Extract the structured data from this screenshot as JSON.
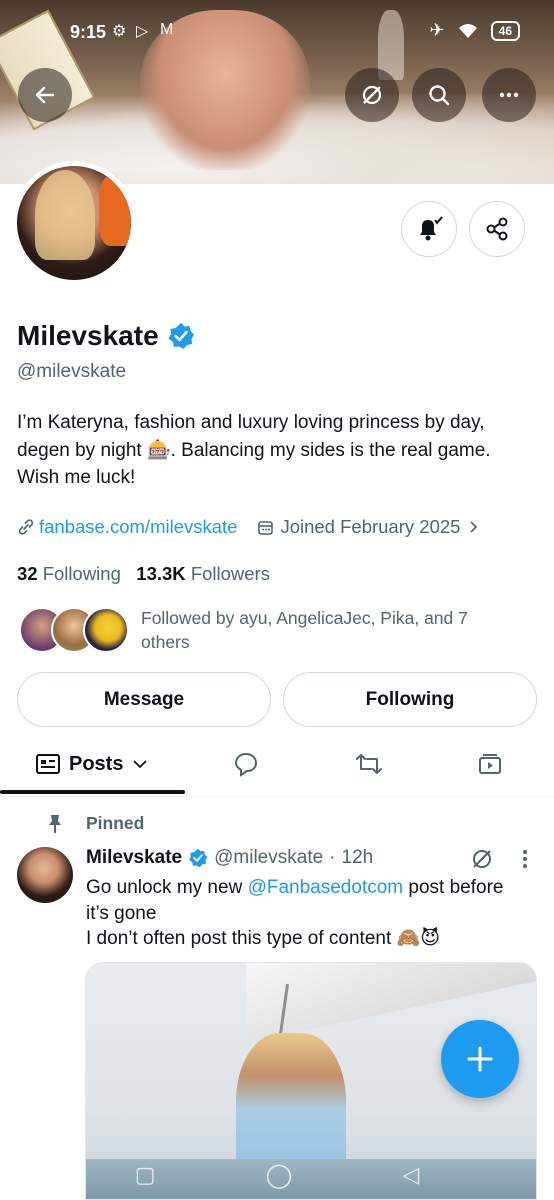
{
  "status_bar": {
    "time": "9:15",
    "left_icons": [
      "gear-icon",
      "play-store-icon",
      "gmail-icon"
    ],
    "right_icons": [
      "airplane-icon",
      "wifi-icon"
    ],
    "battery": "46"
  },
  "header": {
    "back_icon": "arrow-left-icon",
    "actions": [
      "grok-icon",
      "search-icon",
      "more-icon"
    ]
  },
  "profile": {
    "name": "Milevskate",
    "verified": true,
    "handle": "@milevskate",
    "bio": "I’m Kateryna,  fashion and luxury loving princess by day, degen by night 🎰. Balancing my sides is the real game. Wish me luck!",
    "website": "fanbase.com/milevskate",
    "joined": "Joined February 2025",
    "following_count": "32",
    "following_label": "Following",
    "followers_count": "13.3K",
    "followers_label": "Followers",
    "followed_by": "Followed by ayu, AngelicaJec, Pika, and 7 others"
  },
  "buttons": {
    "message": "Message",
    "following": "Following"
  },
  "tabs": {
    "posts": "Posts",
    "replies_icon": "reply-icon",
    "reposts_icon": "repost-icon",
    "media_icon": "video-icon"
  },
  "pinned_post": {
    "pinned_label": "Pinned",
    "name": "Milevskate",
    "handle": "@milevskate",
    "separator": "·",
    "time": "12h",
    "text_before": "Go unlock my new ",
    "mention": "@Fanbasedotcom",
    "text_after": " post before it’s gone",
    "line2": "I don’t often post this type of content 🙈😈"
  },
  "colors": {
    "accent": "#1d9bf0",
    "text": "#0f1419",
    "muted": "#536471",
    "border": "#cfd9de"
  }
}
